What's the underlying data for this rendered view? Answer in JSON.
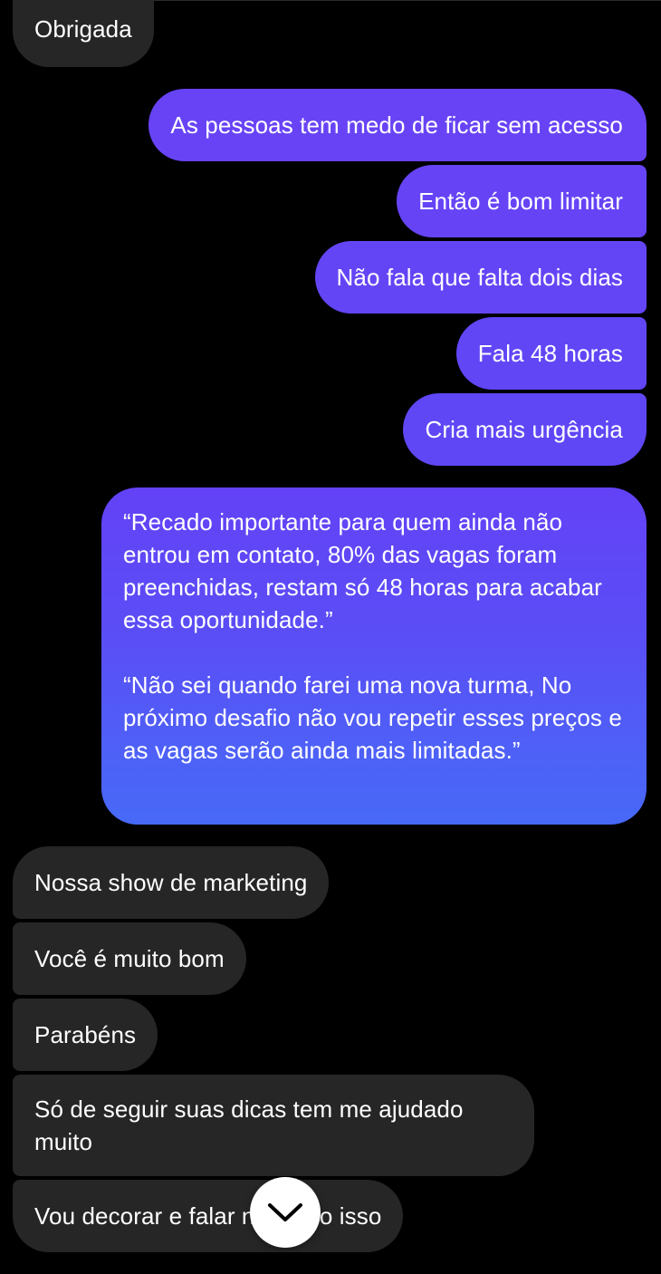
{
  "messages": {
    "received_1": "Obrigada",
    "sent_1": "As pessoas tem medo de ficar sem acesso",
    "sent_2": "Então é bom limitar",
    "sent_3": "Não fala que falta dois dias",
    "sent_4": "Fala 48 horas",
    "sent_5": "Cria mais urgência",
    "sent_6_para_1": "“Recado importante para quem ainda não entrou em contato, 80% das vagas foram preenchidas, restam só 48 horas para acabar essa oportunidade.”",
    "sent_6_para_2": "“Não sei quando farei uma nova turma, No próximo desafio não vou repetir esses preços e as vagas serão ainda mais limitadas.”",
    "received_2": "Nossa show de marketing",
    "received_3": "Você é muito bom",
    "received_4": "Parabéns",
    "received_5": "Só de seguir suas dicas tem me ajudado muito",
    "received_6": "Vou decorar e falar no vídeo isso"
  },
  "scroll_button": {
    "icon": "chevron-down-icon"
  },
  "colors": {
    "background": "#000000",
    "received_bubble": "#262626",
    "sent_gradient_top": "#6342f6",
    "sent_gradient_bottom": "#4769f7",
    "text": "#ffffff"
  }
}
